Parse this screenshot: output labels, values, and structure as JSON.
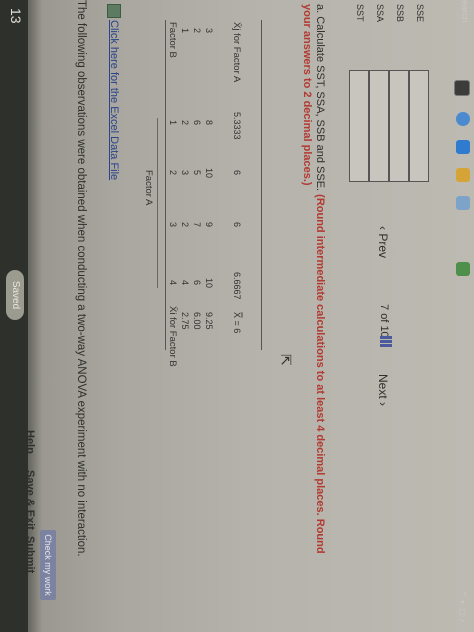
{
  "header": {
    "page_number": "13",
    "saved": "Saved",
    "help": "Help",
    "save_exit": "Save & Exit",
    "submit": "Submit",
    "check_work": "Check my work"
  },
  "question": {
    "prompt": "The following observations were obtained when conducting a two-way ANOVA experiment with no interaction.",
    "excel_link": "Click here for the Excel Data File"
  },
  "table": {
    "factor_a_label": "Factor A",
    "factor_b_label": "Factor B",
    "col_headers": [
      "1",
      "2",
      "3",
      "4"
    ],
    "row_mean_header": "X̄i for Factor B",
    "rows": [
      {
        "label": "1",
        "values": [
          "2",
          "3",
          "2",
          "4"
        ],
        "mean": "2.75"
      },
      {
        "label": "2",
        "values": [
          "6",
          "5",
          "7",
          "6"
        ],
        "mean": "6.00"
      },
      {
        "label": "3",
        "values": [
          "8",
          "10",
          "9",
          "10"
        ],
        "mean": "9.25"
      }
    ],
    "col_mean_label": "X̄j for Factor A",
    "col_means": [
      "5.3333",
      "6",
      "6",
      "6.6667"
    ],
    "grand_mean": "X̿ = 6"
  },
  "part_a": {
    "text": "a. Calculate SST, SSA, SSB and SSE.",
    "instruction": "(Round intermediate calculations to at least 4 decimal places. Round your answers to 2 decimal places.)",
    "inputs": [
      {
        "label": "SST",
        "value": ""
      },
      {
        "label": "SSA",
        "value": ""
      },
      {
        "label": "SSB",
        "value": ""
      },
      {
        "label": "SSE",
        "value": ""
      }
    ]
  },
  "pagination": {
    "prev": "Prev",
    "page": "7",
    "of": "of",
    "total": "10",
    "next": "Next"
  },
  "taskbar": {
    "search": "earch"
  }
}
